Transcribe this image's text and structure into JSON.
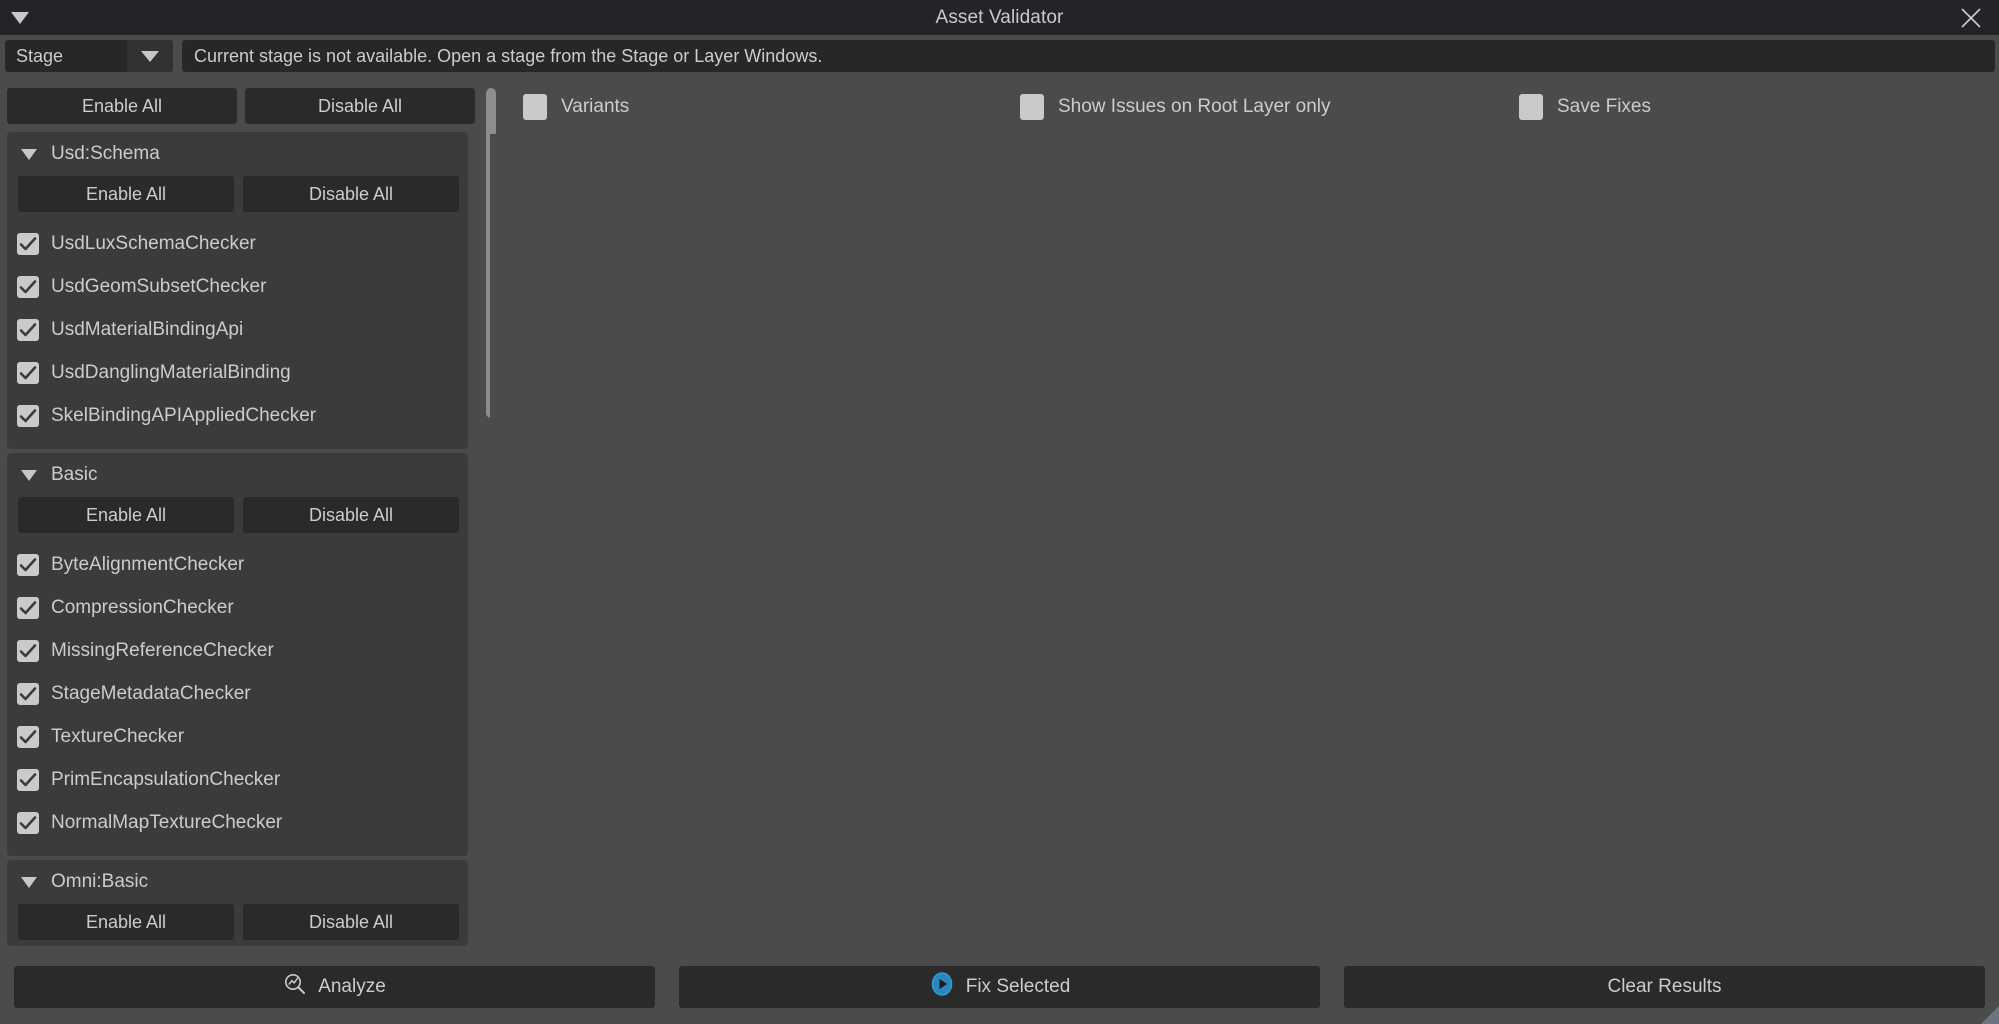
{
  "window": {
    "title": "Asset Validator",
    "collapse_icon": "triangle-down-icon",
    "close_icon": "close-icon"
  },
  "stage_bar": {
    "selector_value": "Stage",
    "selector_arrow_icon": "chevron-down-icon",
    "status_message": "Current stage is not available. Open a stage from the Stage or Layer Windows."
  },
  "master_controls": {
    "enable_all_label": "Enable All",
    "disable_all_label": "Disable All"
  },
  "options": [
    {
      "id": "variants",
      "label": "Variants",
      "checked": false
    },
    {
      "id": "root_layer",
      "label": "Show Issues on Root Layer only",
      "checked": false
    },
    {
      "id": "save_fixes",
      "label": "Save Fixes",
      "checked": false
    }
  ],
  "groups": [
    {
      "title": "Usd:Schema",
      "expanded": true,
      "enable_all_label": "Enable All",
      "disable_all_label": "Disable All",
      "items": [
        {
          "label": "UsdLuxSchemaChecker",
          "checked": true
        },
        {
          "label": "UsdGeomSubsetChecker",
          "checked": true
        },
        {
          "label": "UsdMaterialBindingApi",
          "checked": true
        },
        {
          "label": "UsdDanglingMaterialBinding",
          "checked": true
        },
        {
          "label": "SkelBindingAPIAppliedChecker",
          "checked": true
        }
      ]
    },
    {
      "title": "Basic",
      "expanded": true,
      "enable_all_label": "Enable All",
      "disable_all_label": "Disable All",
      "items": [
        {
          "label": "ByteAlignmentChecker",
          "checked": true
        },
        {
          "label": "CompressionChecker",
          "checked": true
        },
        {
          "label": "MissingReferenceChecker",
          "checked": true
        },
        {
          "label": "StageMetadataChecker",
          "checked": true
        },
        {
          "label": "TextureChecker",
          "checked": true
        },
        {
          "label": "PrimEncapsulationChecker",
          "checked": true
        },
        {
          "label": "NormalMapTextureChecker",
          "checked": true
        }
      ]
    },
    {
      "title": "Omni:Basic",
      "expanded": true,
      "enable_all_label": "Enable All",
      "disable_all_label": "Disable All",
      "items": []
    }
  ],
  "footer": {
    "analyze_label": "Analyze",
    "analyze_icon": "analyze-magnifier-icon",
    "fix_selected_label": "Fix Selected",
    "fix_selected_icon": "play-circle-icon",
    "clear_results_label": "Clear Results"
  },
  "colors": {
    "window_bg": "#232427",
    "panel_bg": "#4a4b4d",
    "group_bg": "#3a3b3c",
    "button_bg": "#2a2a2b",
    "field_bg": "#272727",
    "text": "#cbcccd",
    "checkbox": "#c9cacb",
    "accent_blue": "#2b87bb",
    "scrollbar": "#8c8d8e"
  }
}
